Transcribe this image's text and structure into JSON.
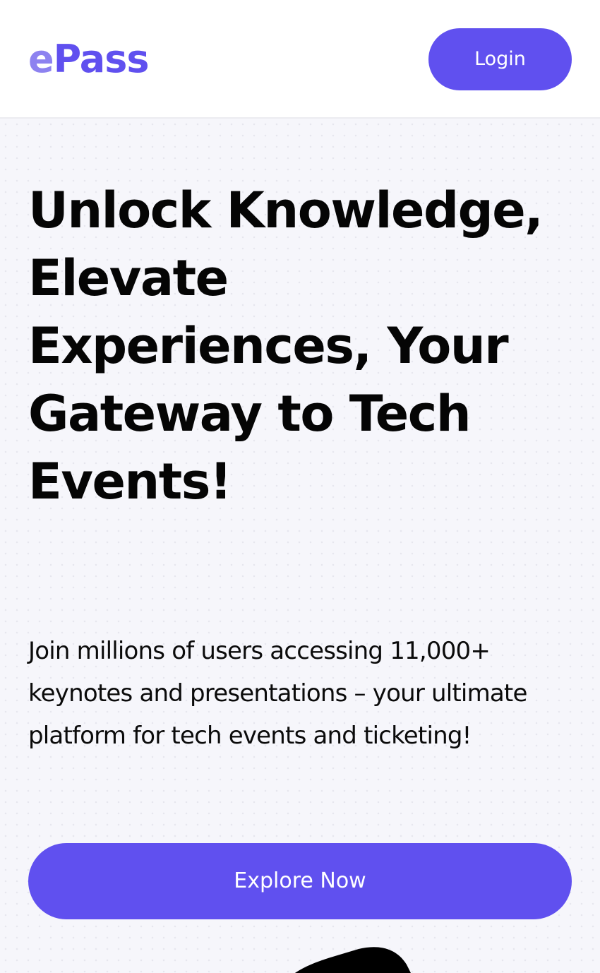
{
  "header": {
    "logo": {
      "first": "e",
      "rest": "Pass"
    },
    "login_label": "Login"
  },
  "hero": {
    "headline": "Unlock Knowledge, Elevate Experiences, Your Gateway to Tech Events!",
    "subtext": "Join millions of users accessing 11,000+ keynotes and presentations – your ultimate platform for tech events and ticketing!",
    "cta_label": "Explore Now"
  },
  "colors": {
    "accent": "#6050ef",
    "logo_light": "#8d82f0",
    "hero_background": "#f6f6fb",
    "text": "#050505"
  }
}
